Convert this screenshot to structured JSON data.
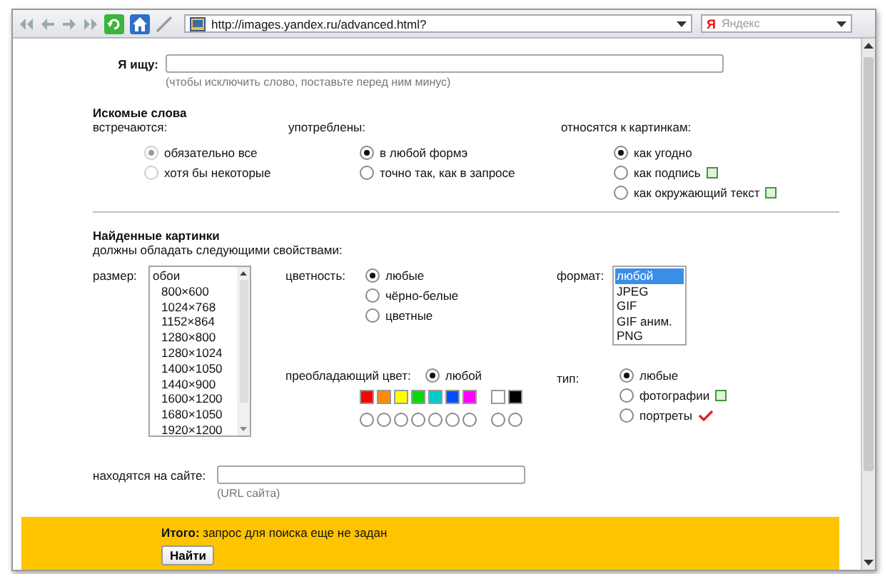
{
  "toolbar": {
    "address": "http://images.yandex.ru/advanced.html?",
    "search_logo": "Я",
    "search_placeholder": "Яндекс"
  },
  "query": {
    "label": "Я ищу:",
    "hint": "(чтобы исключить слово, поставьте перед ним минус)"
  },
  "words": {
    "title": "Искомые слова",
    "groups": [
      {
        "label": "встречаются:",
        "disabled": true,
        "options": [
          {
            "label": "обязательно все",
            "selected": true,
            "help": false
          },
          {
            "label": "хотя бы некоторые",
            "selected": false,
            "help": false
          }
        ]
      },
      {
        "label": "употреблены:",
        "disabled": false,
        "options": [
          {
            "label": "в любой формэ",
            "selected": true,
            "help": false
          },
          {
            "label": "точно так, как в запросе",
            "selected": false,
            "help": false
          }
        ]
      },
      {
        "label": "относятся к картинкам:",
        "disabled": false,
        "options": [
          {
            "label": "как угодно",
            "selected": true,
            "help": false
          },
          {
            "label": "как подпись",
            "selected": false,
            "help": true
          },
          {
            "label": "как окружающий текст",
            "selected": false,
            "help": true
          }
        ]
      }
    ]
  },
  "found": {
    "title": "Найденные картинки",
    "subtitle": "должны обладать следующими свойствами:",
    "size": {
      "label": "размер:",
      "items": [
        {
          "label": "обои",
          "children": [
            {
              "label": "800×600"
            },
            {
              "label": "1024×768"
            },
            {
              "label": "1152×864"
            },
            {
              "label": "1280×800"
            },
            {
              "label": "1280×1024"
            },
            {
              "label": "1400×1050"
            },
            {
              "label": "1440×900"
            },
            {
              "label": "1600×1200"
            },
            {
              "label": "1680×1050"
            },
            {
              "label": "1920×1200"
            }
          ]
        }
      ]
    },
    "colorness": {
      "label": "цветность:",
      "options": [
        {
          "label": "любые",
          "selected": true
        },
        {
          "label": "чёрно-белые",
          "selected": false
        },
        {
          "label": "цветные",
          "selected": false
        }
      ]
    },
    "format": {
      "label": "формат:",
      "items": [
        {
          "label": "любой",
          "selected": true
        },
        {
          "label": "JPEG",
          "selected": false
        },
        {
          "label": "GIF",
          "selected": false
        },
        {
          "label": "GIF аним.",
          "selected": false
        },
        {
          "label": "PNG",
          "selected": false
        }
      ]
    },
    "dominant": {
      "label": "преобладающий цвет:",
      "any": {
        "label": "любой",
        "selected": true
      },
      "groups": [
        [
          {
            "color": "#ff0000",
            "selected": false
          },
          {
            "color": "#ff8c00",
            "selected": false
          },
          {
            "color": "#ffff00",
            "selected": false
          },
          {
            "color": "#00dd00",
            "selected": false
          },
          {
            "color": "#00cccc",
            "selected": false
          },
          {
            "color": "#0050ff",
            "selected": false
          },
          {
            "color": "#ff00ff",
            "selected": false
          }
        ],
        [
          {
            "color": "#ffffff",
            "selected": false
          },
          {
            "color": "#000000",
            "selected": false
          }
        ]
      ]
    },
    "type": {
      "label": "тип:",
      "options": [
        {
          "label": "любые",
          "selected": true,
          "help": false,
          "marked": false
        },
        {
          "label": "фотографии",
          "selected": false,
          "help": true,
          "marked": false
        },
        {
          "label": "портреты",
          "selected": false,
          "help": false,
          "marked": true
        }
      ]
    }
  },
  "site": {
    "label": "находятся на сайте:",
    "hint": "(URL сайта)"
  },
  "total": {
    "text": "**Итого:** запрос для поиска еще не задан",
    "button": "Найти"
  }
}
